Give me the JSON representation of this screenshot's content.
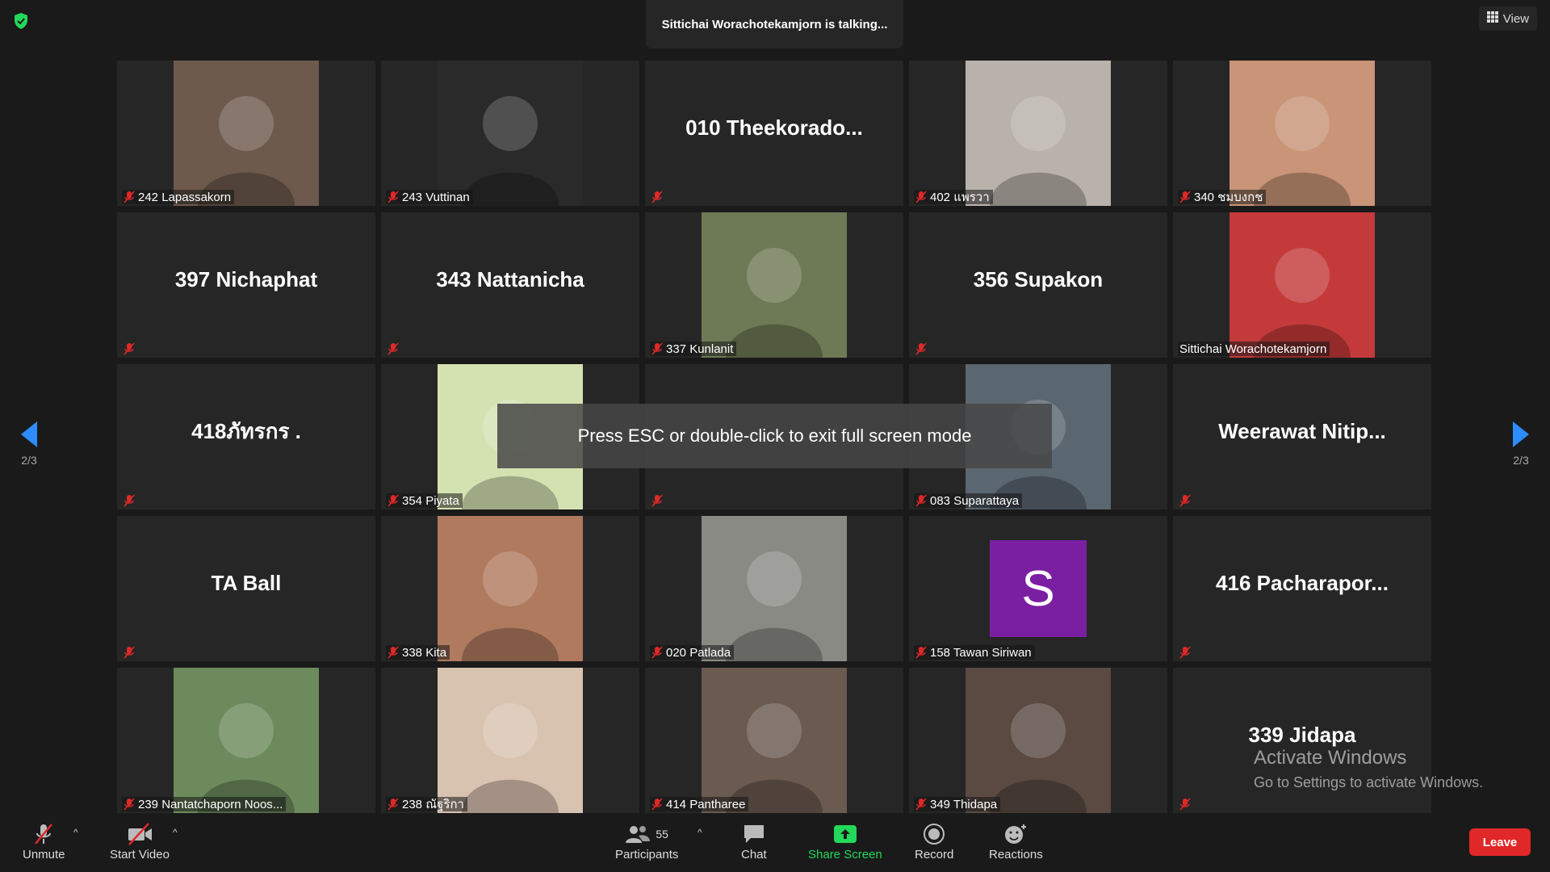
{
  "header": {
    "talking_text": "Sittichai Worachotekamjorn is talking...",
    "view_label": "View"
  },
  "pager": {
    "page_label": "2/3"
  },
  "tiles": [
    {
      "kind": "photo",
      "label": "242 Lapassakorn",
      "muted": true,
      "bg": "#6d5a4c"
    },
    {
      "kind": "photo",
      "label": "243 Vuttinan",
      "muted": true,
      "bg": "#2a2a2a"
    },
    {
      "kind": "name",
      "big_name": "010  Theekorado...",
      "label": "",
      "muted": true
    },
    {
      "kind": "photo",
      "label": "402 แพรวา",
      "muted": true,
      "bg": "#b8b2aa"
    },
    {
      "kind": "photo",
      "label": "340 ชมบงกช",
      "muted": true,
      "bg": "#c99477"
    },
    {
      "kind": "name",
      "big_name": "397 Nichaphat",
      "label": "",
      "muted": true
    },
    {
      "kind": "name",
      "big_name": "343 Nattanicha",
      "label": "",
      "muted": true
    },
    {
      "kind": "photo",
      "label": "337 Kunlanit",
      "muted": true,
      "bg": "#6e7a55"
    },
    {
      "kind": "name",
      "big_name": "356 Supakon",
      "label": "",
      "muted": true
    },
    {
      "kind": "photo",
      "label": "Sittichai Worachotekamjorn",
      "muted": false,
      "bg": "#c43a3a"
    },
    {
      "kind": "name",
      "big_name": "418ภัทรกร .",
      "label": "",
      "muted": true
    },
    {
      "kind": "photo",
      "label": "354 Piyata",
      "muted": true,
      "bg": "#d4e2b2"
    },
    {
      "kind": "name",
      "big_name": "",
      "label": "",
      "muted": true
    },
    {
      "kind": "photo",
      "label": "083 Suparattaya",
      "muted": true,
      "bg": "#5a6670"
    },
    {
      "kind": "name",
      "big_name": "Weerawat  Nitip...",
      "label": "",
      "muted": true
    },
    {
      "kind": "name",
      "big_name": "TA Ball",
      "label": "",
      "muted": true
    },
    {
      "kind": "photo",
      "label": "338 Kita",
      "muted": true,
      "bg": "#b07a5e"
    },
    {
      "kind": "photo",
      "label": "020 Patlada",
      "muted": true,
      "bg": "#8a8a85"
    },
    {
      "kind": "avatar",
      "avatar_letter": "S",
      "label": "158 Tawan Siriwan",
      "muted": true,
      "bg": "#7b1fa2"
    },
    {
      "kind": "name",
      "big_name": "416  Pacharapor...",
      "label": "",
      "muted": true
    },
    {
      "kind": "photo",
      "label": "239 Nantatchaporn Noos...",
      "muted": true,
      "bg": "#6c8a5c"
    },
    {
      "kind": "photo",
      "label": "238 ณัฐริกา",
      "muted": true,
      "bg": "#d8c2b0"
    },
    {
      "kind": "photo",
      "label": "414 Panthare​e",
      "muted": true,
      "bg": "#6a5a50"
    },
    {
      "kind": "photo",
      "label": "349 Thidapa",
      "muted": true,
      "bg": "#5a4a42"
    },
    {
      "kind": "name",
      "big_name": "339 Jidapa",
      "label": "",
      "muted": true
    }
  ],
  "overlay": {
    "esc_text": "Press ESC or double-click to exit full screen mode"
  },
  "watermark": {
    "title": "Activate Windows",
    "subtitle": "Go to Settings to activate Windows."
  },
  "toolbar": {
    "unmute_label": "Unmute",
    "start_video_label": "Start Video",
    "participants_label": "Participants",
    "participants_count": "55",
    "chat_label": "Chat",
    "share_screen_label": "Share Screen",
    "record_label": "Record",
    "reactions_label": "Reactions",
    "leave_label": "Leave"
  },
  "colors": {
    "share_green": "#23d959",
    "arrow_blue": "#2d8cff",
    "leave_red": "#e02828",
    "muted_red": "#e02828",
    "secure_green": "#23d959"
  }
}
